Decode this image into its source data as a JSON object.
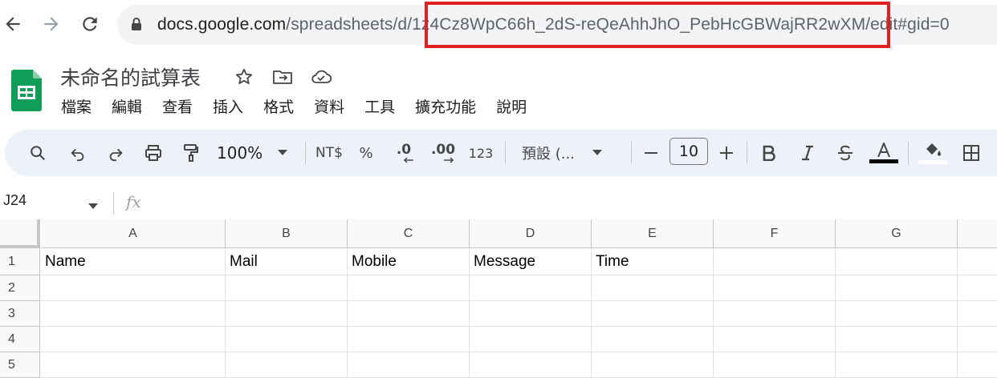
{
  "browser": {
    "url_host": "docs.google.com",
    "url_path_prefix": "/spreadsheets/d/",
    "url_doc_id": "1z4Cz8WpC66h_2dS-reQeAhhJhO_PebHcGBWajRR2wXM",
    "url_path_suffix": "/edit#gid=0",
    "highlight_color": "#e02020"
  },
  "app": {
    "doc_title": "未命名的試算表",
    "logo_color": "#0f9d58",
    "menus": [
      "檔案",
      "編輯",
      "查看",
      "插入",
      "格式",
      "資料",
      "工具",
      "擴充功能",
      "說明"
    ]
  },
  "toolbar": {
    "zoom": "100%",
    "currency": "NT$",
    "percent": "%",
    "decrease_decimal": ".0",
    "increase_decimal": ".00",
    "number_format": "123",
    "font": "預設 (...",
    "font_size": "10",
    "text_color": "#000000"
  },
  "formula_bar": {
    "cell_ref": "J24",
    "fx": "fx"
  },
  "grid": {
    "columns": [
      "A",
      "B",
      "C",
      "D",
      "E",
      "F",
      "G"
    ],
    "rows": [
      {
        "num": "1",
        "cells": [
          "Name",
          "Mail",
          "Mobile",
          "Message",
          "Time",
          "",
          ""
        ]
      },
      {
        "num": "2",
        "cells": [
          "",
          "",
          "",
          "",
          "",
          "",
          ""
        ]
      },
      {
        "num": "3",
        "cells": [
          "",
          "",
          "",
          "",
          "",
          "",
          ""
        ]
      },
      {
        "num": "4",
        "cells": [
          "",
          "",
          "",
          "",
          "",
          "",
          ""
        ]
      },
      {
        "num": "5",
        "cells": [
          "",
          "",
          "",
          "",
          "",
          "",
          ""
        ]
      }
    ]
  }
}
